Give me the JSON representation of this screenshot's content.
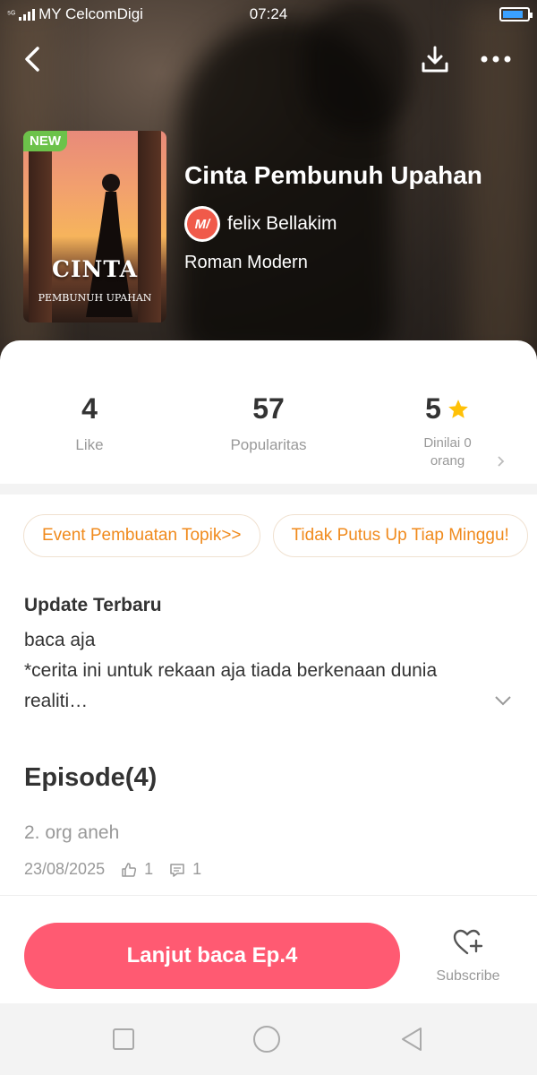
{
  "status_bar": {
    "network_badge": "⁵ᴳ",
    "carrier": "MY CelcomDigi",
    "time": "07:24"
  },
  "header": {
    "back_icon": "chevron-left-icon",
    "download_icon": "download-icon",
    "more_icon": "more-horizontal-icon"
  },
  "book": {
    "badge": "NEW",
    "cover_title": "CINTA",
    "cover_subtitle": "PEMBUNUH UPAHAN",
    "title": "Cinta Pembunuh Upahan",
    "author_logo_text": "M/",
    "author": "felix Bellakim",
    "genre": "Roman Modern"
  },
  "stats": {
    "likes_value": "4",
    "likes_label": "Like",
    "popularity_value": "57",
    "popularity_label": "Popularitas",
    "rating_value": "5",
    "rating_label_1": "Dinilai 0",
    "rating_label_2": "orang"
  },
  "tags": [
    {
      "label": "Event Pembuatan Topik>>"
    },
    {
      "label": "Tidak Putus Up Tiap Minggu!"
    }
  ],
  "update": {
    "title": "Update Terbaru",
    "line1": "baca aja",
    "line2": "*cerita ini untuk rekaan aja tiada berkenaan dunia",
    "line3": "realiti…"
  },
  "episodes": {
    "title": "Episode(4)",
    "items": [
      {
        "name": "2. org aneh",
        "date": "23/08/2025",
        "likes": "1",
        "comments": "1"
      }
    ]
  },
  "actions": {
    "continue_label": "Lanjut baca Ep.4",
    "subscribe_label": "Subscribe"
  },
  "colors": {
    "accent": "#ff5a72",
    "tag_text": "#f08a1c",
    "badge_green": "#6cc24a",
    "star": "#ffc107"
  }
}
